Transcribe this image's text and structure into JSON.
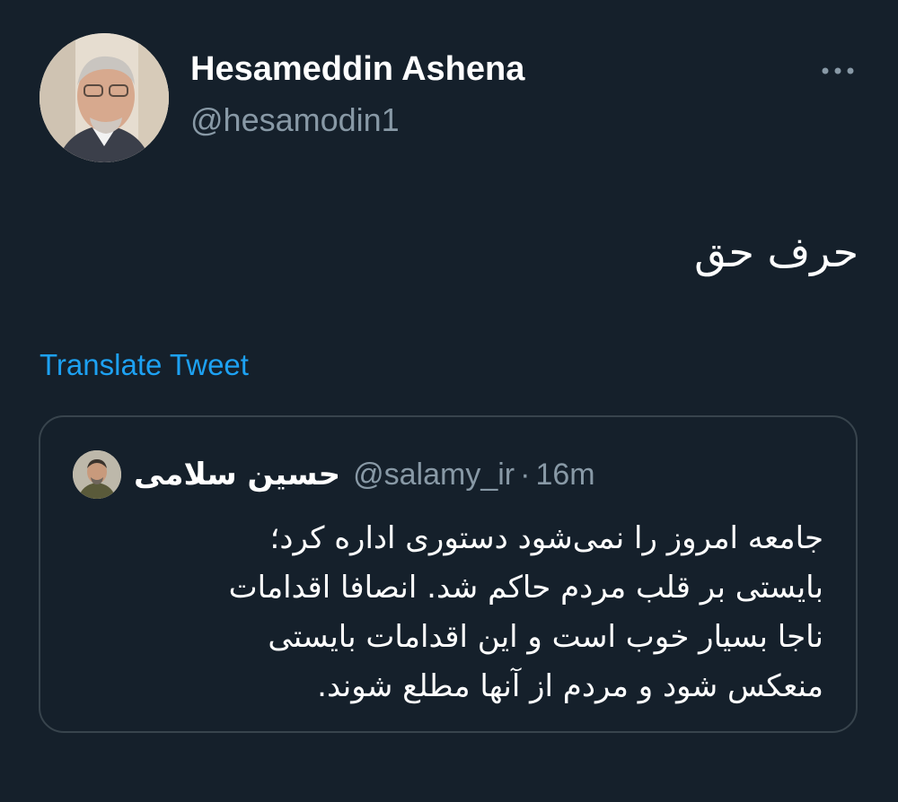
{
  "author": {
    "display_name": "Hesameddin Ashena",
    "handle": "@hesamodin1",
    "avatar_icon": "user-photo-avatar"
  },
  "more_icon": "more-dots-icon",
  "tweet": {
    "text": "حرف حق",
    "translate_label": "Translate Tweet"
  },
  "quoted_tweet": {
    "author_name": "حسین سلامی",
    "handle": "@salamy_ir",
    "separator": "·",
    "time": "16m",
    "avatar_icon": "user-photo-avatar",
    "lines": [
      "جامعه امروز را نمی‌شود دستوری اداره کرد؛",
      "بایستی بر قلب مردم حاکم شد. انصافا اقدامات",
      "ناجا بسیار خوب است و این اقدامات بایستی",
      "منعکس شود و مردم از آنها مطلع شوند."
    ]
  },
  "colors": {
    "background": "#15202b",
    "primary_text": "#ffffff",
    "secondary_text": "#8899a6",
    "link": "#1da1f2",
    "border": "#38444d"
  }
}
